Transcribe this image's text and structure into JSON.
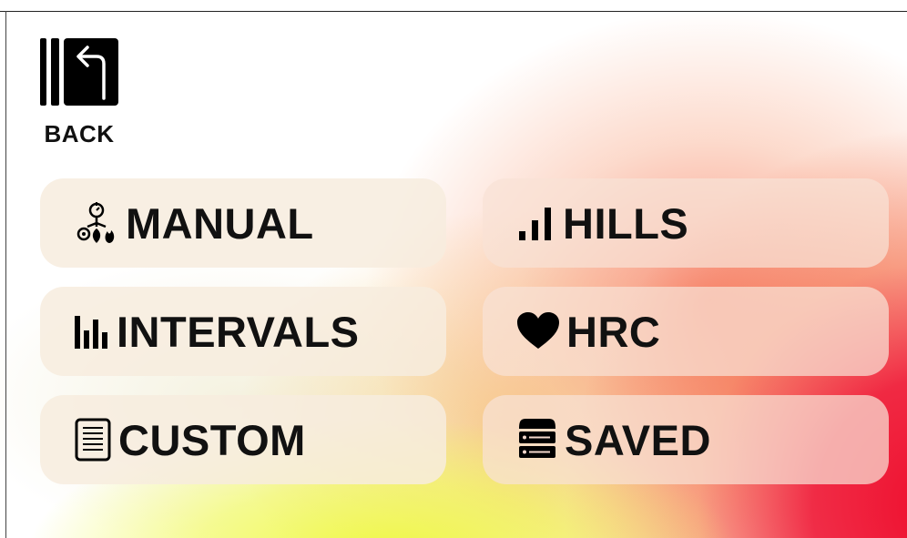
{
  "header": {
    "back_label": "BACK",
    "back_icon": "back-arrow-icon"
  },
  "programs": [
    {
      "label": "MANUAL",
      "icon": "manual-icon"
    },
    {
      "label": "HILLS",
      "icon": "hills-bars-icon"
    },
    {
      "label": "INTERVALS",
      "icon": "intervals-bars-icon"
    },
    {
      "label": "HRC",
      "icon": "heart-icon"
    },
    {
      "label": "CUSTOM",
      "icon": "document-icon"
    },
    {
      "label": "SAVED",
      "icon": "stack-icon"
    }
  ],
  "colors": {
    "text": "#111111",
    "tile": "#f7ecde",
    "accent_red": "#ee0a2a",
    "accent_yellow": "#eef83c"
  }
}
